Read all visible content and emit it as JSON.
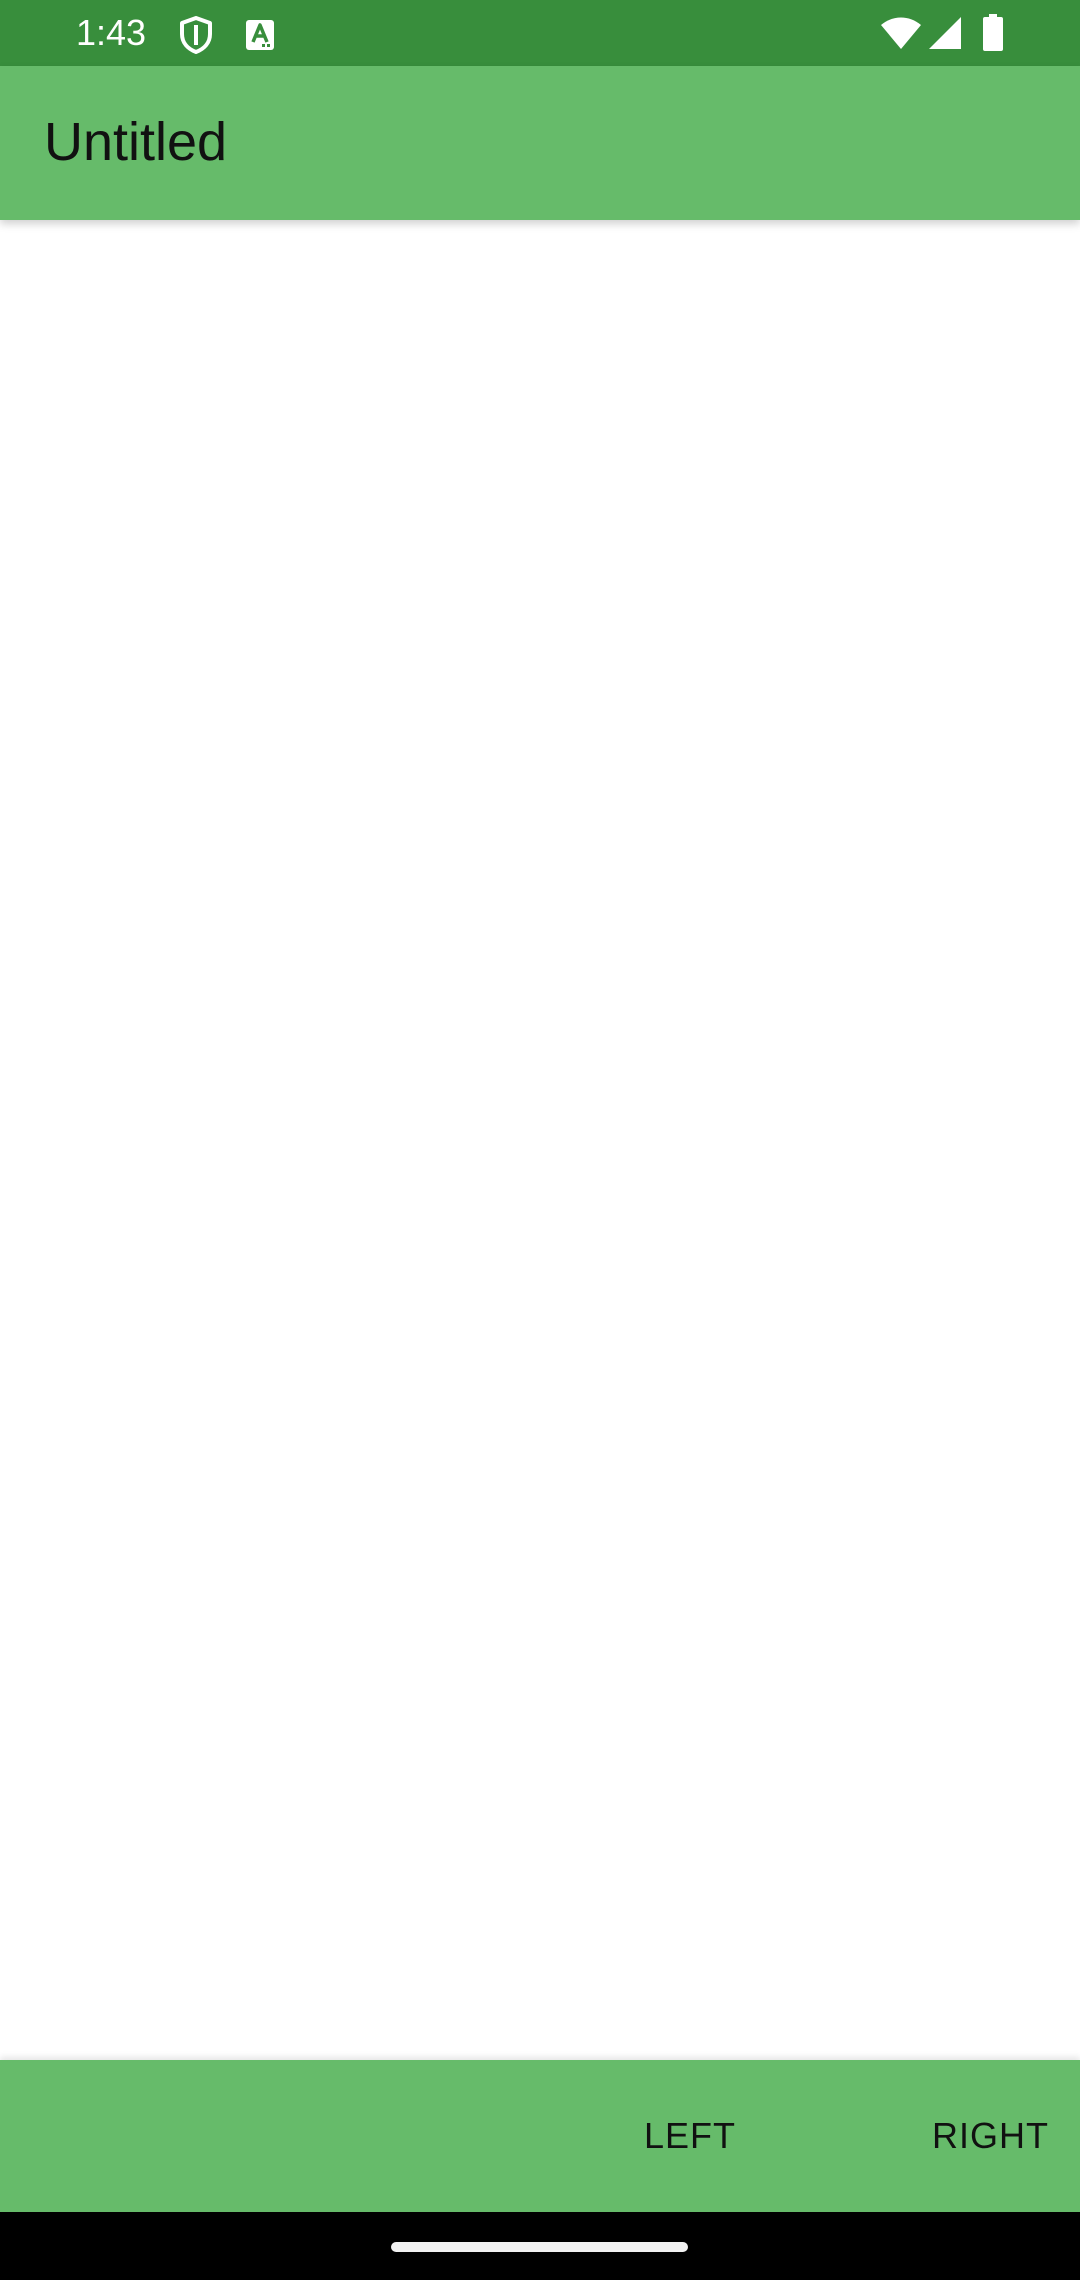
{
  "status_bar": {
    "time": "1:43",
    "icons": [
      "shield-icon",
      "text-recognition-icon",
      "wifi-icon",
      "signal-icon",
      "battery-icon"
    ],
    "color": "#388e3c"
  },
  "app_bar": {
    "title": "Untitled",
    "color": "#66bb6a"
  },
  "bottom_bar": {
    "left_label": "LEFT",
    "right_label": "RIGHT",
    "color": "#66bb6a"
  },
  "nav_bar": {
    "color": "#000000"
  }
}
